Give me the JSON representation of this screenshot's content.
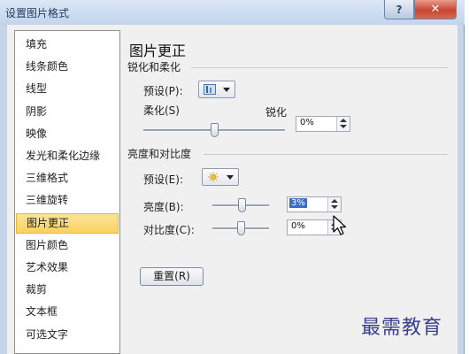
{
  "window": {
    "title": "设置图片格式",
    "help_glyph": "?",
    "close_glyph": "✕"
  },
  "categories": [
    {
      "label": "填充",
      "selected": false
    },
    {
      "label": "线条颜色",
      "selected": false
    },
    {
      "label": "线型",
      "selected": false
    },
    {
      "label": "阴影",
      "selected": false
    },
    {
      "label": "映像",
      "selected": false
    },
    {
      "label": "发光和柔化边缘",
      "selected": false
    },
    {
      "label": "三维格式",
      "selected": false
    },
    {
      "label": "三维旋转",
      "selected": false
    },
    {
      "label": "图片更正",
      "selected": true
    },
    {
      "label": "图片颜色",
      "selected": false
    },
    {
      "label": "艺术效果",
      "selected": false
    },
    {
      "label": "裁剪",
      "selected": false
    },
    {
      "label": "文本框",
      "selected": false
    },
    {
      "label": "可选文字",
      "selected": false
    }
  ],
  "panel": {
    "title": "图片更正",
    "sharpen_section": {
      "heading": "锐化和柔化",
      "preset_label": "预设(P):",
      "soften_label": "柔化(S)",
      "sharpen_label": "锐化",
      "value": "0%",
      "slider_position": 0.5
    },
    "brightness_section": {
      "heading": "亮度和对比度",
      "preset_label": "预设(E):",
      "brightness_label": "亮度(B):",
      "brightness_value": "3%",
      "brightness_slider_position": 0.52,
      "contrast_label": "对比度(C):",
      "contrast_value": "0%",
      "contrast_slider_position": 0.5
    },
    "reset_button": "重置(R)"
  },
  "watermark": "最需教育",
  "colors": {
    "selection": "#f9d25e",
    "frame": "#c6d6ea",
    "accent": "#3a6fc3"
  }
}
